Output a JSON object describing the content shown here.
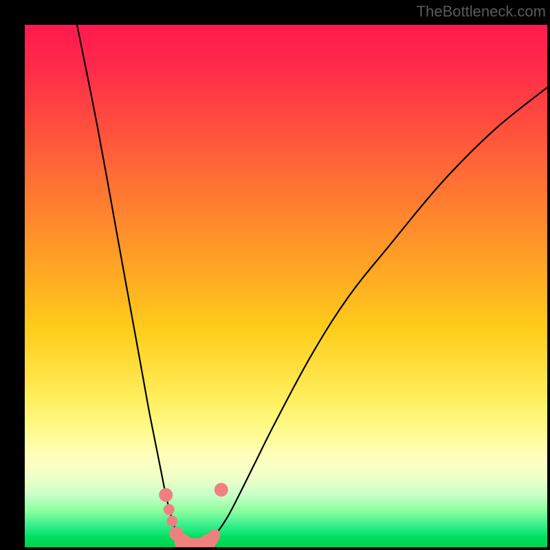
{
  "watermark": "TheBottleneck.com",
  "chart_data": {
    "type": "line",
    "title": "",
    "xlabel": "",
    "ylabel": "",
    "xlim": [
      0,
      100
    ],
    "ylim": [
      0,
      100
    ],
    "grid": false,
    "legend": false,
    "series": [
      {
        "name": "bottleneck-curve",
        "x": [
          10,
          14,
          18,
          22,
          24,
          26,
          27,
          28,
          29,
          30,
          31,
          32,
          33,
          34,
          35,
          36,
          38,
          40,
          44,
          48,
          55,
          62,
          70,
          80,
          90,
          100
        ],
        "y": [
          100,
          80,
          58,
          36,
          25,
          15,
          10,
          6,
          3,
          1.2,
          0.4,
          0.2,
          0.2,
          0.3,
          0.8,
          1.8,
          4.5,
          8,
          16,
          24,
          37,
          48,
          58,
          70,
          80,
          88
        ]
      }
    ],
    "markers": {
      "name": "highlight-points",
      "x": [
        27.0,
        27.6,
        28.2,
        29.0,
        30.2,
        31.4,
        32.6,
        33.8,
        35.0,
        35.8,
        36.4,
        37.6
      ],
      "y": [
        10.0,
        7.2,
        5.0,
        2.6,
        1.0,
        0.3,
        0.2,
        0.3,
        0.9,
        1.6,
        2.4,
        11.0
      ],
      "radius": [
        10,
        8,
        8,
        10,
        12,
        12,
        12,
        12,
        12,
        10,
        8,
        10
      ],
      "color": "#f08080"
    },
    "background_gradient": {
      "top": "#ff1a4d",
      "mid": "#ffe040",
      "bottom": "#00d050"
    }
  }
}
